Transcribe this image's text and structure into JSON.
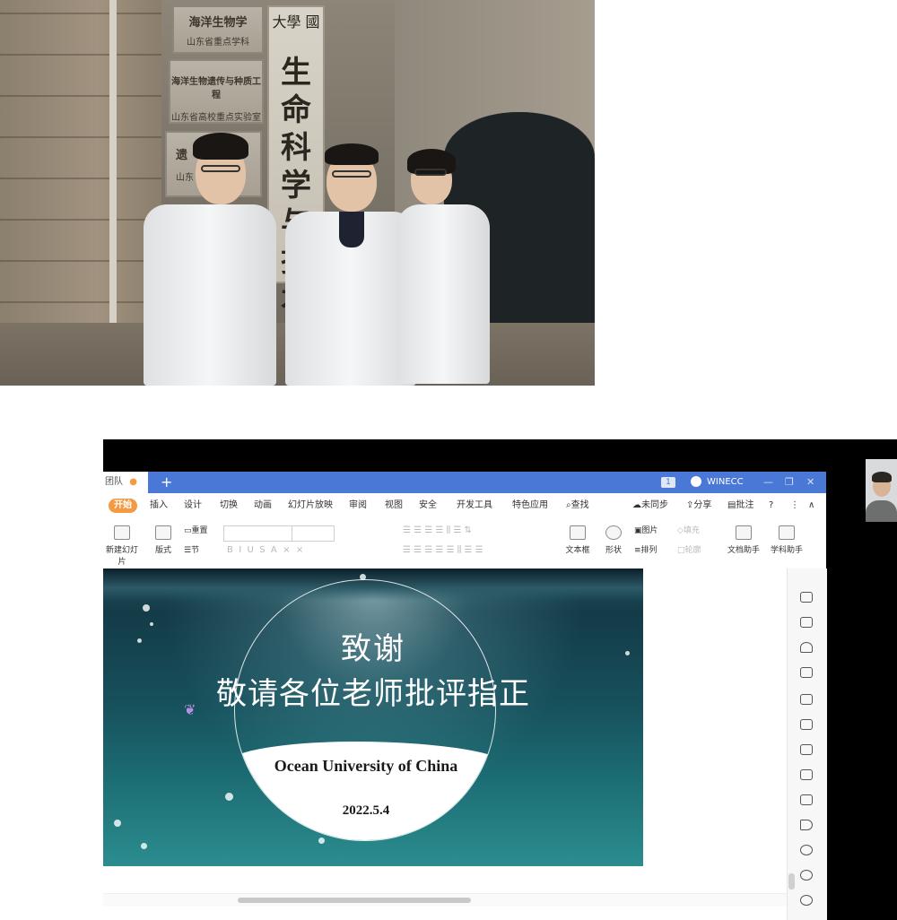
{
  "photo": {
    "plaque1": {
      "line1": "海洋生物学",
      "line2": "山东省重点学科"
    },
    "plaque2": {
      "line1": "海洋生物遗传与种质工程",
      "line2": "山东省高校重点实验室"
    },
    "plaque3": {
      "line1": "遗",
      "line2": "山东"
    },
    "vertical_small": "大學 國",
    "vertical_big": "生命科学与技术学"
  },
  "wps": {
    "team_tab": "团队",
    "new_tab": "+",
    "badge": "1",
    "user": "WINECC",
    "window_controls": [
      "—",
      "❐",
      "✕"
    ],
    "menu": {
      "start": "开始",
      "items": [
        "插入",
        "设计",
        "切换",
        "动画",
        "幻灯片放映",
        "审阅",
        "视图",
        "安全",
        "开发工具",
        "特色应用",
        "查找"
      ],
      "right": [
        "未同步",
        "分享",
        "批注",
        "?",
        "⋮",
        "∧"
      ]
    },
    "toolbar": {
      "new_slide": "新建幻灯片",
      "layout": "版式",
      "reset": "重置",
      "section": "节",
      "textbox": "文本框",
      "shape": "形状",
      "image": "图片",
      "arrange": "排列",
      "fill": "填充",
      "outline": "轮廓",
      "doc_helper": "文档助手",
      "subject_helper": "学科助手"
    },
    "slide": {
      "title": "致谢",
      "subtitle": "敬请各位老师批评指正",
      "university": "Ocean University of China",
      "date": "2022.5.4"
    }
  }
}
